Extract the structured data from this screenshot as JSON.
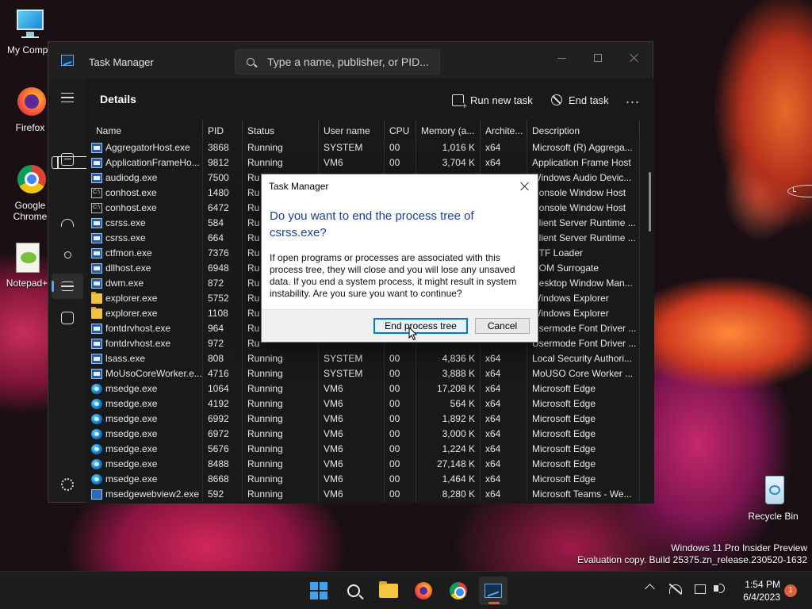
{
  "desktop": {
    "icons": [
      {
        "label": "My Compu"
      },
      {
        "label": "Firefox"
      },
      {
        "label": "Google Chrome"
      },
      {
        "label": "Notepad+"
      },
      {
        "label": "Recycle Bin"
      }
    ],
    "watermark_line1": "Windows 11 Pro Insider Preview",
    "watermark_line2": "Evaluation copy. Build 25375.zn_release.230520-1632"
  },
  "window": {
    "title": "Task Manager",
    "search_placeholder": "Type a name, publisher, or PID...",
    "page_title": "Details",
    "run_new_task": "Run new task",
    "end_task": "End task",
    "more": "..."
  },
  "nav": [
    "menu-icon",
    "processes-icon",
    "performance-icon",
    "app-history-icon",
    "startup-apps-icon",
    "users-icon",
    "details-icon",
    "services-icon",
    "settings-icon"
  ],
  "columns": [
    "Name",
    "PID",
    "Status",
    "User name",
    "CPU",
    "Memory (a...",
    "Archite...",
    "Description"
  ],
  "rows": [
    {
      "icon": "sys",
      "name": "AggregatorHost.exe",
      "pid": "3868",
      "status": "Running",
      "user": "SYSTEM",
      "cpu": "00",
      "mem": "1,016 K",
      "arch": "x64",
      "desc": "Microsoft (R) Aggrega..."
    },
    {
      "icon": "sys",
      "name": "ApplicationFrameHo...",
      "pid": "9812",
      "status": "Running",
      "user": "VM6",
      "cpu": "00",
      "mem": "3,704 K",
      "arch": "x64",
      "desc": "Application Frame Host"
    },
    {
      "icon": "sys",
      "name": "audiodg.exe",
      "pid": "7500",
      "status": "Ru",
      "user": "",
      "cpu": "",
      "mem": "",
      "arch": "",
      "desc": "Windows Audio Devic..."
    },
    {
      "icon": "con",
      "name": "conhost.exe",
      "pid": "1480",
      "status": "Ru",
      "user": "",
      "cpu": "",
      "mem": "",
      "arch": "",
      "desc": "Console Window Host"
    },
    {
      "icon": "con",
      "name": "conhost.exe",
      "pid": "6472",
      "status": "Ru",
      "user": "",
      "cpu": "",
      "mem": "",
      "arch": "",
      "desc": "Console Window Host"
    },
    {
      "icon": "sys",
      "name": "csrss.exe",
      "pid": "584",
      "status": "Ru",
      "user": "",
      "cpu": "",
      "mem": "",
      "arch": "",
      "desc": "Client Server Runtime ..."
    },
    {
      "icon": "sys",
      "name": "csrss.exe",
      "pid": "664",
      "status": "Ru",
      "user": "",
      "cpu": "",
      "mem": "",
      "arch": "",
      "desc": "Client Server Runtime ..."
    },
    {
      "icon": "sys",
      "name": "ctfmon.exe",
      "pid": "7376",
      "status": "Ru",
      "user": "",
      "cpu": "",
      "mem": "",
      "arch": "",
      "desc": "CTF Loader"
    },
    {
      "icon": "sys",
      "name": "dllhost.exe",
      "pid": "6948",
      "status": "Ru",
      "user": "",
      "cpu": "",
      "mem": "",
      "arch": "",
      "desc": "COM Surrogate"
    },
    {
      "icon": "sys",
      "name": "dwm.exe",
      "pid": "872",
      "status": "Ru",
      "user": "",
      "cpu": "",
      "mem": "",
      "arch": "",
      "desc": "Desktop Window Man..."
    },
    {
      "icon": "folder",
      "name": "explorer.exe",
      "pid": "5752",
      "status": "Ru",
      "user": "",
      "cpu": "",
      "mem": "",
      "arch": "",
      "desc": "Windows Explorer"
    },
    {
      "icon": "folder",
      "name": "explorer.exe",
      "pid": "1108",
      "status": "Ru",
      "user": "",
      "cpu": "",
      "mem": "",
      "arch": "",
      "desc": "Windows Explorer"
    },
    {
      "icon": "sys",
      "name": "fontdrvhost.exe",
      "pid": "964",
      "status": "Ru",
      "user": "",
      "cpu": "",
      "mem": "",
      "arch": "",
      "desc": "Usermode Font Driver ..."
    },
    {
      "icon": "sys",
      "name": "fontdrvhost.exe",
      "pid": "972",
      "status": "Ru",
      "user": "",
      "cpu": "",
      "mem": "",
      "arch": "",
      "desc": "Usermode Font Driver ..."
    },
    {
      "icon": "sys",
      "name": "lsass.exe",
      "pid": "808",
      "status": "Running",
      "user": "SYSTEM",
      "cpu": "00",
      "mem": "4,836 K",
      "arch": "x64",
      "desc": "Local Security Authori..."
    },
    {
      "icon": "sys",
      "name": "MoUsoCoreWorker.e...",
      "pid": "4716",
      "status": "Running",
      "user": "SYSTEM",
      "cpu": "00",
      "mem": "3,888 K",
      "arch": "x64",
      "desc": "MoUSO Core Worker ..."
    },
    {
      "icon": "edge",
      "name": "msedge.exe",
      "pid": "1064",
      "status": "Running",
      "user": "VM6",
      "cpu": "00",
      "mem": "17,208 K",
      "arch": "x64",
      "desc": "Microsoft Edge"
    },
    {
      "icon": "edge",
      "name": "msedge.exe",
      "pid": "4192",
      "status": "Running",
      "user": "VM6",
      "cpu": "00",
      "mem": "564 K",
      "arch": "x64",
      "desc": "Microsoft Edge"
    },
    {
      "icon": "edge",
      "name": "msedge.exe",
      "pid": "6992",
      "status": "Running",
      "user": "VM6",
      "cpu": "00",
      "mem": "1,892 K",
      "arch": "x64",
      "desc": "Microsoft Edge"
    },
    {
      "icon": "edge",
      "name": "msedge.exe",
      "pid": "6972",
      "status": "Running",
      "user": "VM6",
      "cpu": "00",
      "mem": "3,000 K",
      "arch": "x64",
      "desc": "Microsoft Edge"
    },
    {
      "icon": "edge",
      "name": "msedge.exe",
      "pid": "5676",
      "status": "Running",
      "user": "VM6",
      "cpu": "00",
      "mem": "1,224 K",
      "arch": "x64",
      "desc": "Microsoft Edge"
    },
    {
      "icon": "edge",
      "name": "msedge.exe",
      "pid": "8488",
      "status": "Running",
      "user": "VM6",
      "cpu": "00",
      "mem": "27,148 K",
      "arch": "x64",
      "desc": "Microsoft Edge"
    },
    {
      "icon": "edge",
      "name": "msedge.exe",
      "pid": "8668",
      "status": "Running",
      "user": "VM6",
      "cpu": "00",
      "mem": "1,464 K",
      "arch": "x64",
      "desc": "Microsoft Edge"
    },
    {
      "icon": "wv",
      "name": "msedgewebview2.exe",
      "pid": "592",
      "status": "Running",
      "user": "VM6",
      "cpu": "00",
      "mem": "8,280 K",
      "arch": "x64",
      "desc": "Microsoft Teams - We..."
    }
  ],
  "dialog": {
    "title": "Task Manager",
    "heading": "Do you want to end the process tree of csrss.exe?",
    "body": "If open programs or processes are associated with this process tree, they will close and you will lose any unsaved data. If you end a system process, it might result in system instability. Are you sure you want to continue?",
    "confirm": "End process tree",
    "cancel": "Cancel"
  },
  "taskbar": {
    "apps": [
      "start-icon",
      "search-icon",
      "file-explorer-icon",
      "firefox-icon",
      "chrome-icon",
      "task-manager-icon"
    ],
    "time": "1:54 PM",
    "date": "6/4/2023",
    "notifications": "1"
  },
  "colors": {
    "accent": "#0078d7",
    "dialog_heading": "#1a3e9c",
    "nav_indicator": "#60a5e8"
  }
}
